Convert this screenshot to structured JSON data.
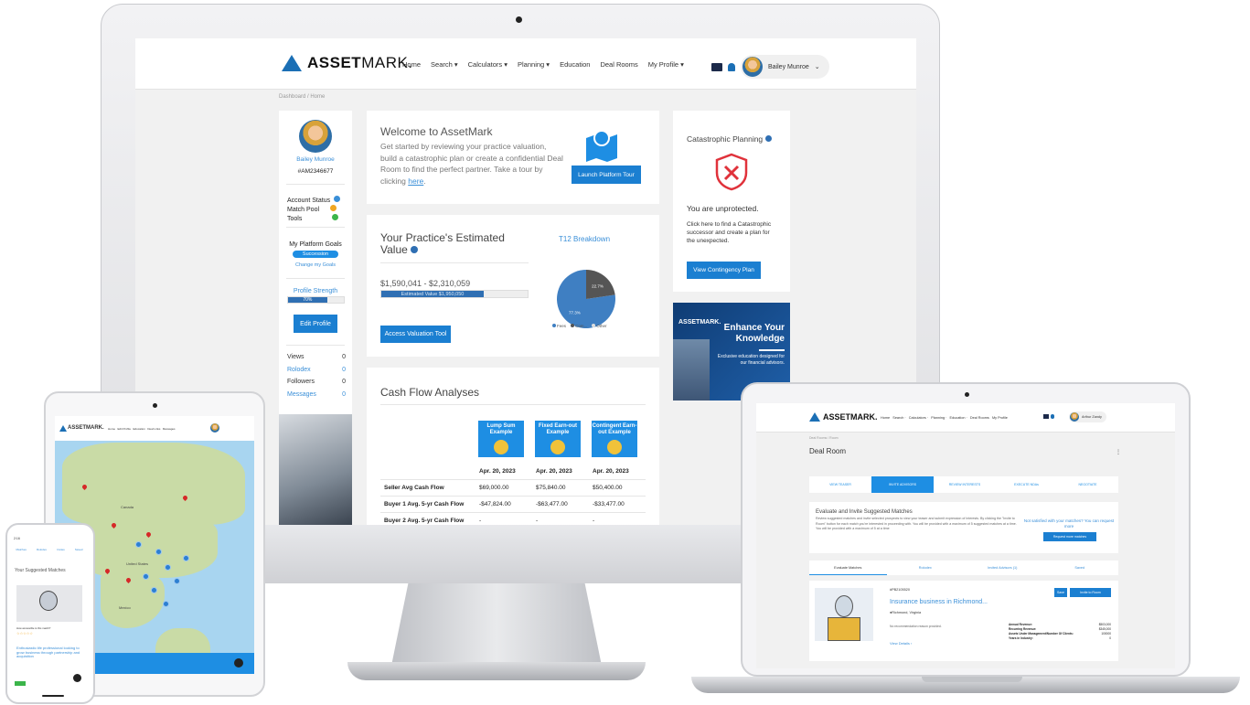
{
  "desktop": {
    "brand": {
      "name_bold": "ASSET",
      "name_rest": "MARK."
    },
    "nav": {
      "items": [
        "Home",
        "Search",
        "Calculators",
        "Planning",
        "Education",
        "Deal Rooms",
        "My Profile"
      ],
      "user_name": "Bailey Munroe"
    },
    "breadcrumb": "Dashboard  /  Home",
    "profile": {
      "name": "Bailey Munroe",
      "id": "#AM2346677",
      "status_labels": [
        "Account Status",
        "Match Pool",
        "Tools"
      ],
      "goals_title": "My Platform Goals",
      "goal_badge": "Succession",
      "change_goals": "Change my Goals",
      "strength_title": "Profile Strength",
      "strength_text": "70%",
      "strength_value": 0.7,
      "edit_button": "Edit Profile",
      "stats": [
        {
          "label": "Views",
          "value": "0"
        },
        {
          "label": "Rolodex",
          "value": "0"
        },
        {
          "label": "Followers",
          "value": "0"
        },
        {
          "label": "Messages",
          "value": "0"
        }
      ]
    },
    "welcome": {
      "title": "Welcome to AssetMark",
      "body": "Get started by reviewing your practice valuation, build a catastrophic plan or create a confidential Deal Room to find the perfect partner. Take a tour by clicking",
      "link": "here",
      "button": "Launch Platform Tour"
    },
    "valuation": {
      "title": "Your Practice's Estimated Value",
      "range": "$1,590,041 - $2,310,059",
      "bar_label": "Estimated Value $1,950,050",
      "bar_value": 0.7,
      "button": "Access Valuation Tool",
      "t12_title": "T12 Breakdown"
    },
    "cashflow": {
      "title": "Cash Flow Analyses",
      "columns": [
        {
          "label": "Lump Sum Example",
          "date": "Apr. 20, 2023"
        },
        {
          "label": "Fixed Earn-out Example",
          "date": "Apr. 20, 2023"
        },
        {
          "label": "Contingent Earn-out Example",
          "date": "Apr. 20, 2023"
        }
      ],
      "rows": [
        {
          "label": "Seller Avg Cash Flow",
          "values": [
            "$69,000.00",
            "$75,840.00",
            "$50,400.00"
          ]
        },
        {
          "label": "Buyer 1 Avg. 5-yr Cash Flow",
          "values": [
            "-$47,824.00",
            "-$63,477.00",
            "-$33,477.00"
          ]
        },
        {
          "label": "Buyer 2 Avg. 5-yr Cash Flow",
          "values": [
            "-",
            "-",
            "-"
          ]
        }
      ]
    },
    "catastrophic": {
      "title": "Catastrophic Planning",
      "status": "You are unprotected.",
      "body": "Click here to find a Catastrophic successor and create a plan for the unexpected.",
      "button": "View Contingency Plan"
    },
    "ad": {
      "brand": "ASSETMARK.",
      "headline": "Enhance Your Knowledge",
      "body": "Exclusive education designed for our financial advisors."
    }
  },
  "chart_data": {
    "type": "pie",
    "title": "T12 Breakdown",
    "categories": [
      "Fees",
      "Com...",
      "Other"
    ],
    "values": [
      77.3,
      22.7,
      0
    ],
    "slice_labels": [
      "77.3%",
      "22.7%"
    ],
    "colors": [
      "#3f7fc2",
      "#555555",
      "#dddddd"
    ],
    "legend": "bottom"
  },
  "laptop": {
    "brand": "ASSETMARK.",
    "nav": "Home   Search ·   Calculators ·   Planning ·   Education ·   Deal Rooms   My Profile",
    "user": "Arthur Zandy",
    "breadcrumb": "Deal Rooms  /  Room",
    "page_title": "Deal Room",
    "steps": [
      "VIEW TEASER",
      "INVITE ADVISORS",
      "REVIEW INTERESTS",
      "EXECUTE NDAs",
      "NEGOTIATE"
    ],
    "evaluate_title": "Evaluate and Invite Suggested Matches",
    "evaluate_body": "Review suggested matches and invite selected prospects to view your teaser and submit expression of interests. By clicking the \"Invite to Room\" button for each match you're interested in proceeding with. You will be provided with a maximum of 5 suggested matches at a time. You will be provided with a maximum of 5 at a time",
    "not_satisfied": "Not satisfied with your matches? You can request more",
    "request_button": "Request more matches",
    "tabs": [
      "Evaluate Matches",
      "Rolodex",
      "Invited Advisors (1)",
      "Saved"
    ],
    "match": {
      "id": "#PB2105520",
      "title": "Insurance business in Richmond...",
      "location": "Richmond, Virginia",
      "recommendation": "No recommendation reason provided.",
      "view_details": "View Details",
      "save": "Save",
      "invite": "Invite to Room",
      "stats": [
        {
          "label": "Annual Revenue:",
          "value": "$503,000"
        },
        {
          "label": "Recurring Revenue:",
          "value": "$345,000"
        },
        {
          "label": "Assets Under Management/Number Of Clients:",
          "value": "100000"
        },
        {
          "label": "Years in Industry:",
          "value": "0"
        }
      ]
    }
  },
  "tablet": {
    "brand": "ASSETMARK.",
    "nav": "Home   Edit Profile   Education   Deal Links   Messages",
    "map_labels": [
      "Canada",
      "United States",
      "Mexico"
    ]
  },
  "phone": {
    "time": "2:16",
    "tabs": [
      "Matches",
      "Rolodex",
      "Invites",
      "Saved"
    ],
    "heading": "Your Suggested Matches",
    "match_title": "Enthusiastic life professional looking to grow business through partnership and acquisition",
    "question": "How accessible is this match?"
  }
}
